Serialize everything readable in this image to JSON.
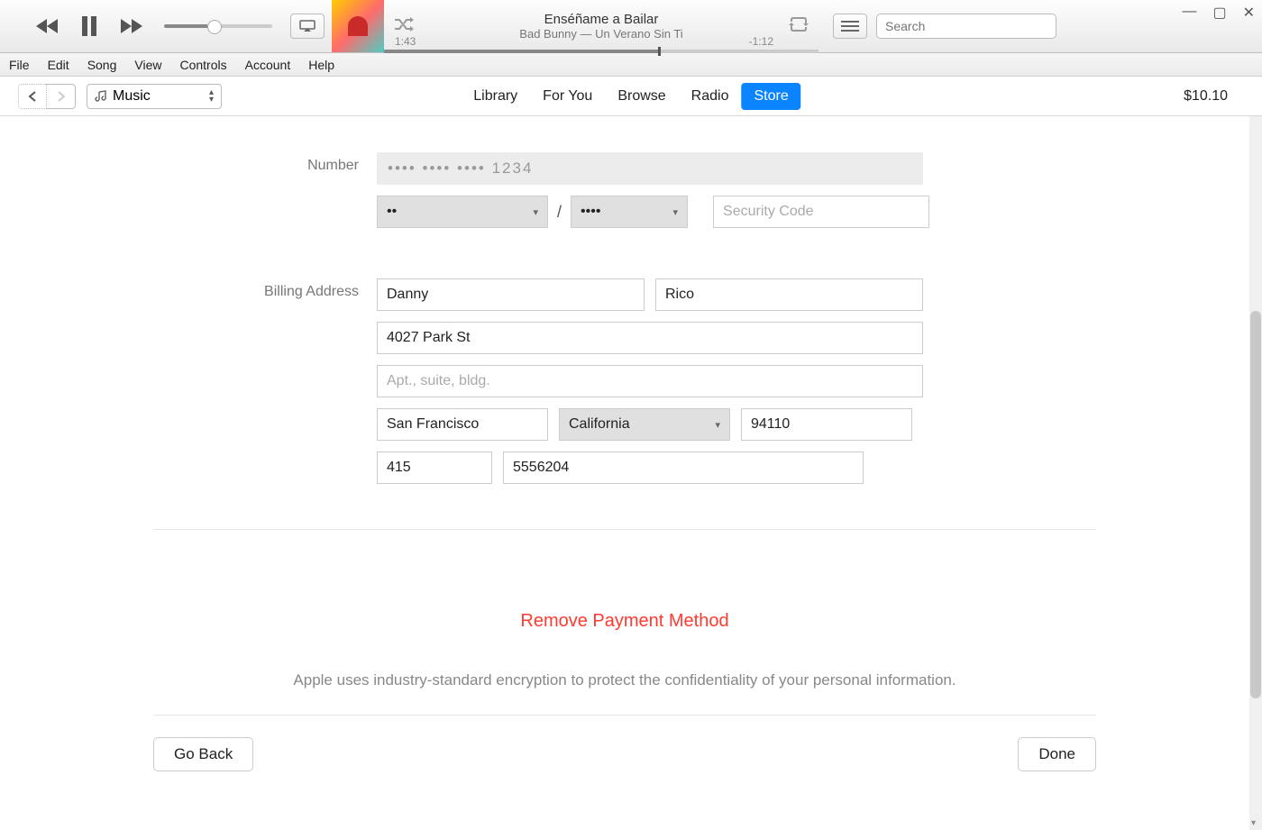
{
  "window": {
    "minimize": "—",
    "maximize": "▢",
    "close": "✕"
  },
  "player": {
    "track_title": "Enséñame a Bailar",
    "track_sub": "Bad Bunny — Un Verano Sin Ti",
    "elapsed": "1:43",
    "remaining": "-1:12",
    "search_placeholder": "Search"
  },
  "menubar": [
    "File",
    "Edit",
    "Song",
    "View",
    "Controls",
    "Account",
    "Help"
  ],
  "nav": {
    "media_kind": "Music",
    "tabs": [
      {
        "label": "Library",
        "active": false
      },
      {
        "label": "For You",
        "active": false
      },
      {
        "label": "Browse",
        "active": false
      },
      {
        "label": "Radio",
        "active": false
      },
      {
        "label": "Store",
        "active": true
      }
    ],
    "balance": "$10.10"
  },
  "form": {
    "number_label": "Number",
    "card_mask": "•••• •••• •••• 1234",
    "exp_month": "••",
    "exp_sep": "/",
    "exp_year": "••••",
    "cvv_placeholder": "Security Code",
    "billing_label": "Billing Address",
    "first_name": "Danny",
    "last_name": "Rico",
    "street": "4027 Park St",
    "apt_placeholder": "Apt., suite, bldg.",
    "city": "San Francisco",
    "state": "California",
    "zip": "94110",
    "phone_area": "415",
    "phone_num": "5556204"
  },
  "actions": {
    "remove": "Remove Payment Method",
    "encrypt": "Apple uses industry-standard encryption to protect the confidentiality of your personal information.",
    "go_back": "Go Back",
    "done": "Done"
  }
}
